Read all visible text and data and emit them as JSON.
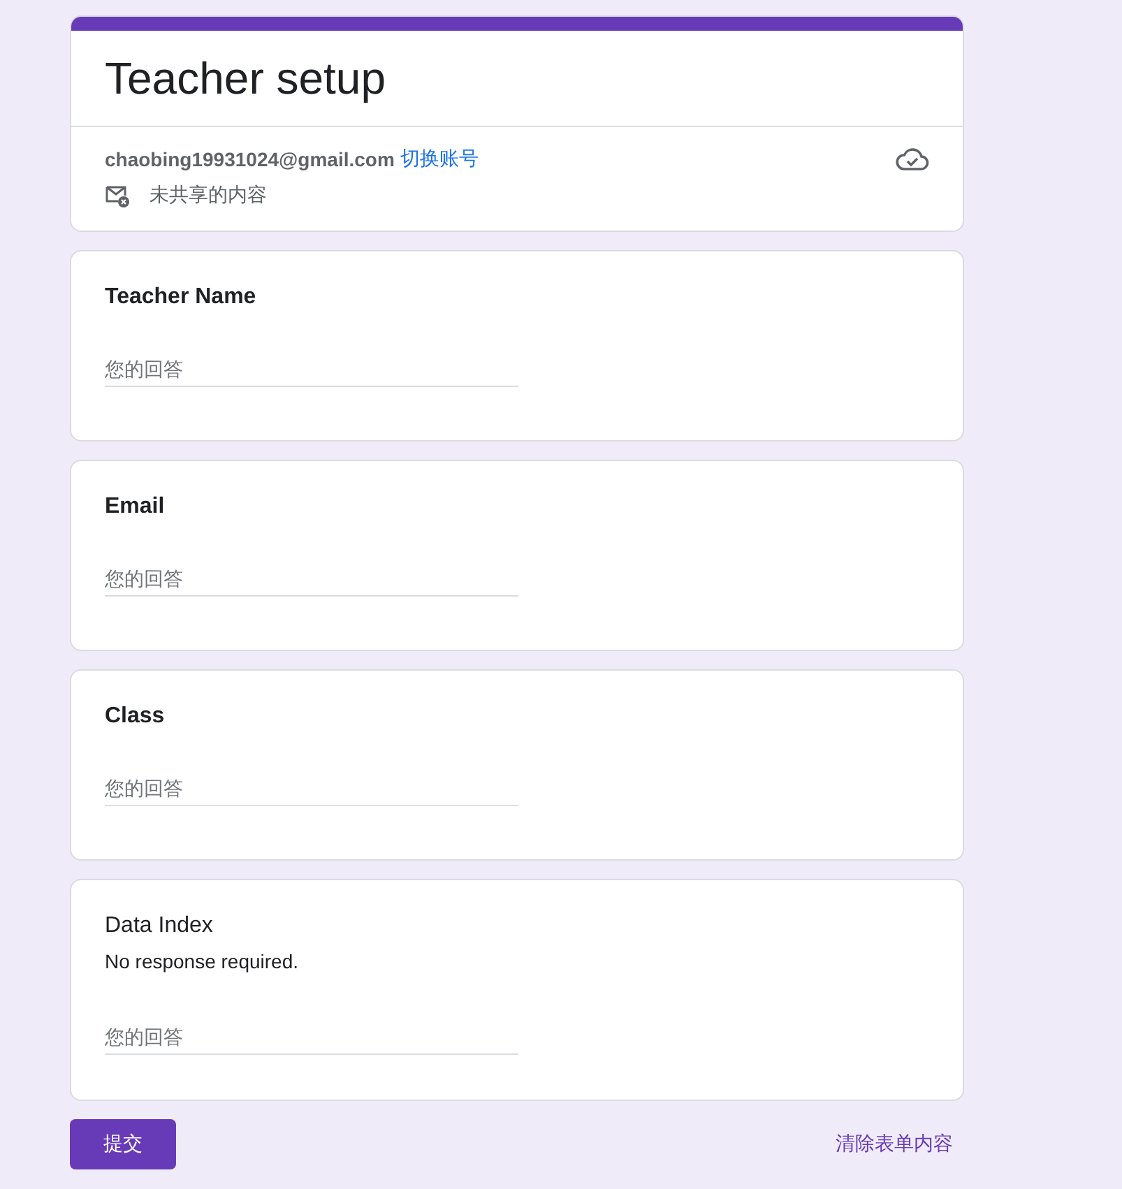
{
  "form": {
    "title": "Teacher setup",
    "account": "chaobing19931024@gmail.com",
    "switch_link": "切换账号",
    "not_shared": "未共享的内容"
  },
  "questions": [
    {
      "kind": "question",
      "title": "Teacher Name",
      "placeholder": "您的回答"
    },
    {
      "kind": "question",
      "title": "Email",
      "placeholder": "您的回答"
    },
    {
      "kind": "question",
      "title": "Class",
      "placeholder": "您的回答"
    },
    {
      "kind": "described",
      "title": "Data Index",
      "description": "No response required.",
      "placeholder": "您的回答"
    }
  ],
  "submit": "提交",
  "clear": "清除表单内容"
}
